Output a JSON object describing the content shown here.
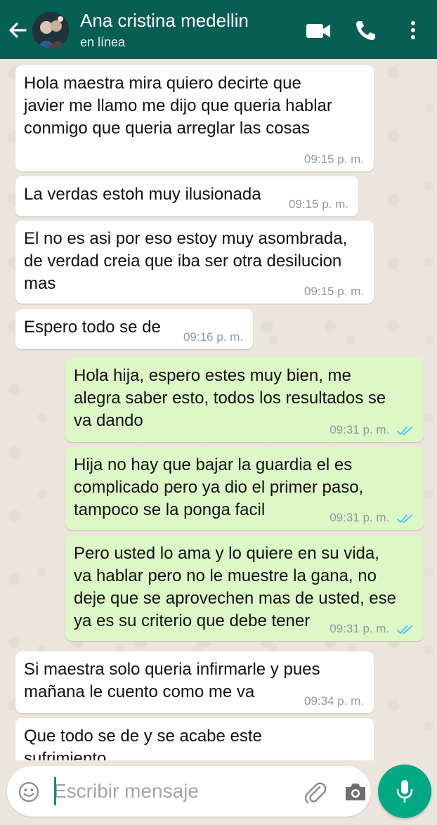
{
  "header": {
    "contact_name": "Ana cristina medellin",
    "status": "en línea"
  },
  "messages": [
    {
      "direction": "in",
      "lines": [
        "Hola maestra mira quiero decirte que",
        "javier me llamo me dijo que queria hablar",
        "conmigo que queria arreglar las cosas"
      ],
      "time": "09:15 p. m."
    },
    {
      "direction": "in",
      "lines": [
        "La verdas estoh muy ilusionada"
      ],
      "time": "09:15 p. m."
    },
    {
      "direction": "in",
      "lines": [
        "El no es asi por eso estoy muy asombrada,",
        "de verdad creia que iba ser otra desilucion",
        "mas"
      ],
      "time": "09:15 p. m."
    },
    {
      "direction": "in",
      "lines": [
        "Espero todo se de"
      ],
      "time": "09:16 p. m."
    },
    {
      "direction": "out",
      "lines": [
        "Hola hija, espero estes muy bien, me",
        "alegra saber esto, todos los resultados se",
        "va dando"
      ],
      "time": "09:31 p. m.",
      "status": "read"
    },
    {
      "direction": "out",
      "lines": [
        "Hija no hay que bajar la guardia el es",
        "complicado pero ya dio el primer paso,",
        "tampoco se la ponga facil"
      ],
      "time": "09:31 p. m.",
      "status": "read"
    },
    {
      "direction": "out",
      "lines": [
        "Pero usted lo ama y lo quiere en su vida,",
        "va hablar pero no le muestre la gana, no",
        "deje que se aprovechen mas de usted, ese",
        "ya es su criterio que debe tener"
      ],
      "time": "09:31 p. m.",
      "status": "read"
    },
    {
      "direction": "in",
      "lines": [
        "Si maestra solo queria infirmarle y pues",
        "mañana le cuento como me va"
      ],
      "time": "09:34 p. m."
    },
    {
      "direction": "in",
      "lines": [
        "Que todo se de y se acabe este",
        "sufrimiento"
      ],
      "time": ""
    }
  ],
  "composer": {
    "placeholder": "Escribir mensaje"
  },
  "colors": {
    "header": "#075e54",
    "incoming_bubble": "#ffffff",
    "outgoing_bubble": "#dcf8c6",
    "read_ticks": "#4fc3f7",
    "mic_button": "#00a884"
  },
  "icons": [
    "back-arrow-icon",
    "video-call-icon",
    "phone-icon",
    "more-options-icon",
    "emoji-icon",
    "attach-icon",
    "camera-icon",
    "mic-icon"
  ]
}
